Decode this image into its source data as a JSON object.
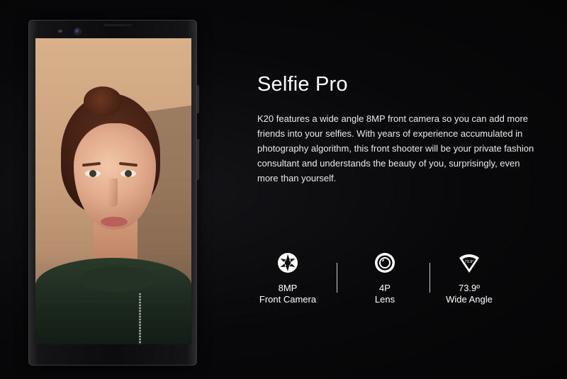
{
  "feature_section": {
    "title": "Selfie Pro",
    "description": "K20 features a wide angle 8MP front camera so you can add more friends into your selfies. With years of experience accumulated in photography algorithm, this front shooter will be your private fashion consultant and understands the beauty of you, surprisingly, even more than yourself."
  },
  "specs": [
    {
      "icon": "aperture-icon",
      "line1": "8MP",
      "line2": "Front Camera"
    },
    {
      "icon": "lens-icon",
      "line1": "4P",
      "line2": "Lens"
    },
    {
      "icon": "wide-angle-icon",
      "icon_label": "73.9°",
      "line1": "73.9º",
      "line2": "Wide Angle"
    }
  ],
  "colors": {
    "background": "#070709",
    "text": "#ffffff"
  }
}
